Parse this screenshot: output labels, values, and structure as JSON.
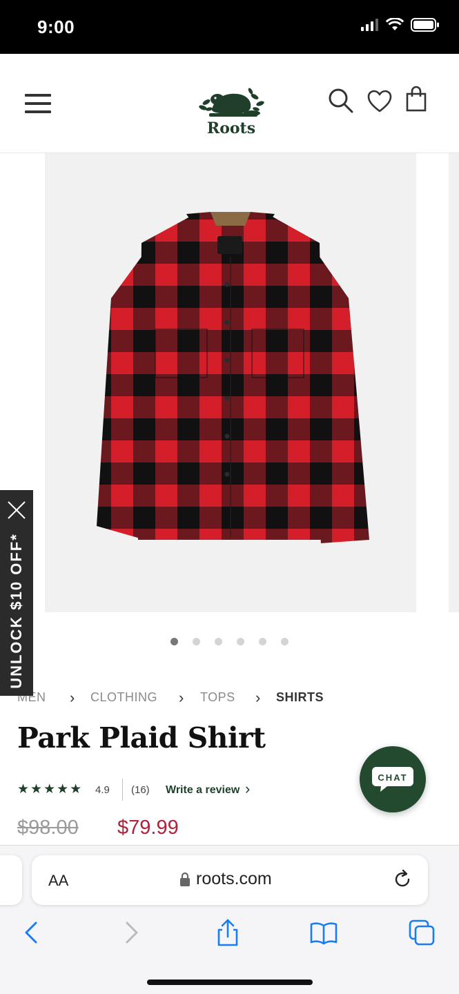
{
  "status_bar": {
    "time": "9:00"
  },
  "header": {
    "logo_text": "Roots",
    "icons": [
      "menu-icon",
      "search-icon",
      "heart-icon",
      "bag-icon"
    ]
  },
  "gallery": {
    "image_count": 6,
    "active_index": 0
  },
  "promo": {
    "label": "UNLOCK $10 OFF*"
  },
  "breadcrumb": [
    {
      "label": "MEN"
    },
    {
      "label": "CLOTHING"
    },
    {
      "label": "TOPS"
    },
    {
      "label": "SHIRTS"
    }
  ],
  "product": {
    "title": "Park Plaid Shirt",
    "stars": "★★★★★",
    "rating": "4.9",
    "review_count": "(16)",
    "write_review": "Write a review",
    "old_price": "$98.00",
    "price": "$79.99"
  },
  "chat": {
    "label": "CHAT"
  },
  "browser": {
    "aa_label": "AA",
    "url": "roots.com"
  },
  "colors": {
    "brand_green": "#1f3f2b",
    "sale_red": "#b0213a",
    "ios_blue": "#1a7cf2"
  }
}
